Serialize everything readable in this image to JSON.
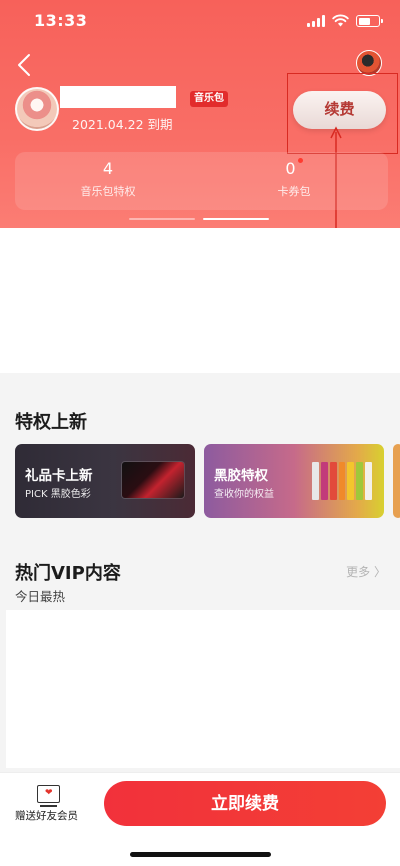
{
  "status_bar": {
    "time": "13:33"
  },
  "header": {
    "music_badge": "音乐包",
    "expire_date": "2021.04.22 到期",
    "renew_button": "续费",
    "stats": [
      {
        "value": "4",
        "label": "音乐包特权",
        "has_dot": false
      },
      {
        "value": "0",
        "label": "卡券包",
        "has_dot": true
      }
    ]
  },
  "privileges": {
    "title": "特权上新",
    "cards": [
      {
        "title": "礼品卡上新",
        "subtitle": "PICK 黑胶色彩"
      },
      {
        "title": "黑胶特权",
        "subtitle": "查收你的权益"
      }
    ]
  },
  "hot_vip": {
    "title": "热门VIP内容",
    "subtitle": "今日最热",
    "more": "更多 〉"
  },
  "bottom": {
    "gift_label": "赠送好友会员",
    "cta_label": "立即续费"
  },
  "colors": {
    "header_top": "#f7615a",
    "accent_red": "#f2313b",
    "highlight_red": "#d82a22"
  }
}
